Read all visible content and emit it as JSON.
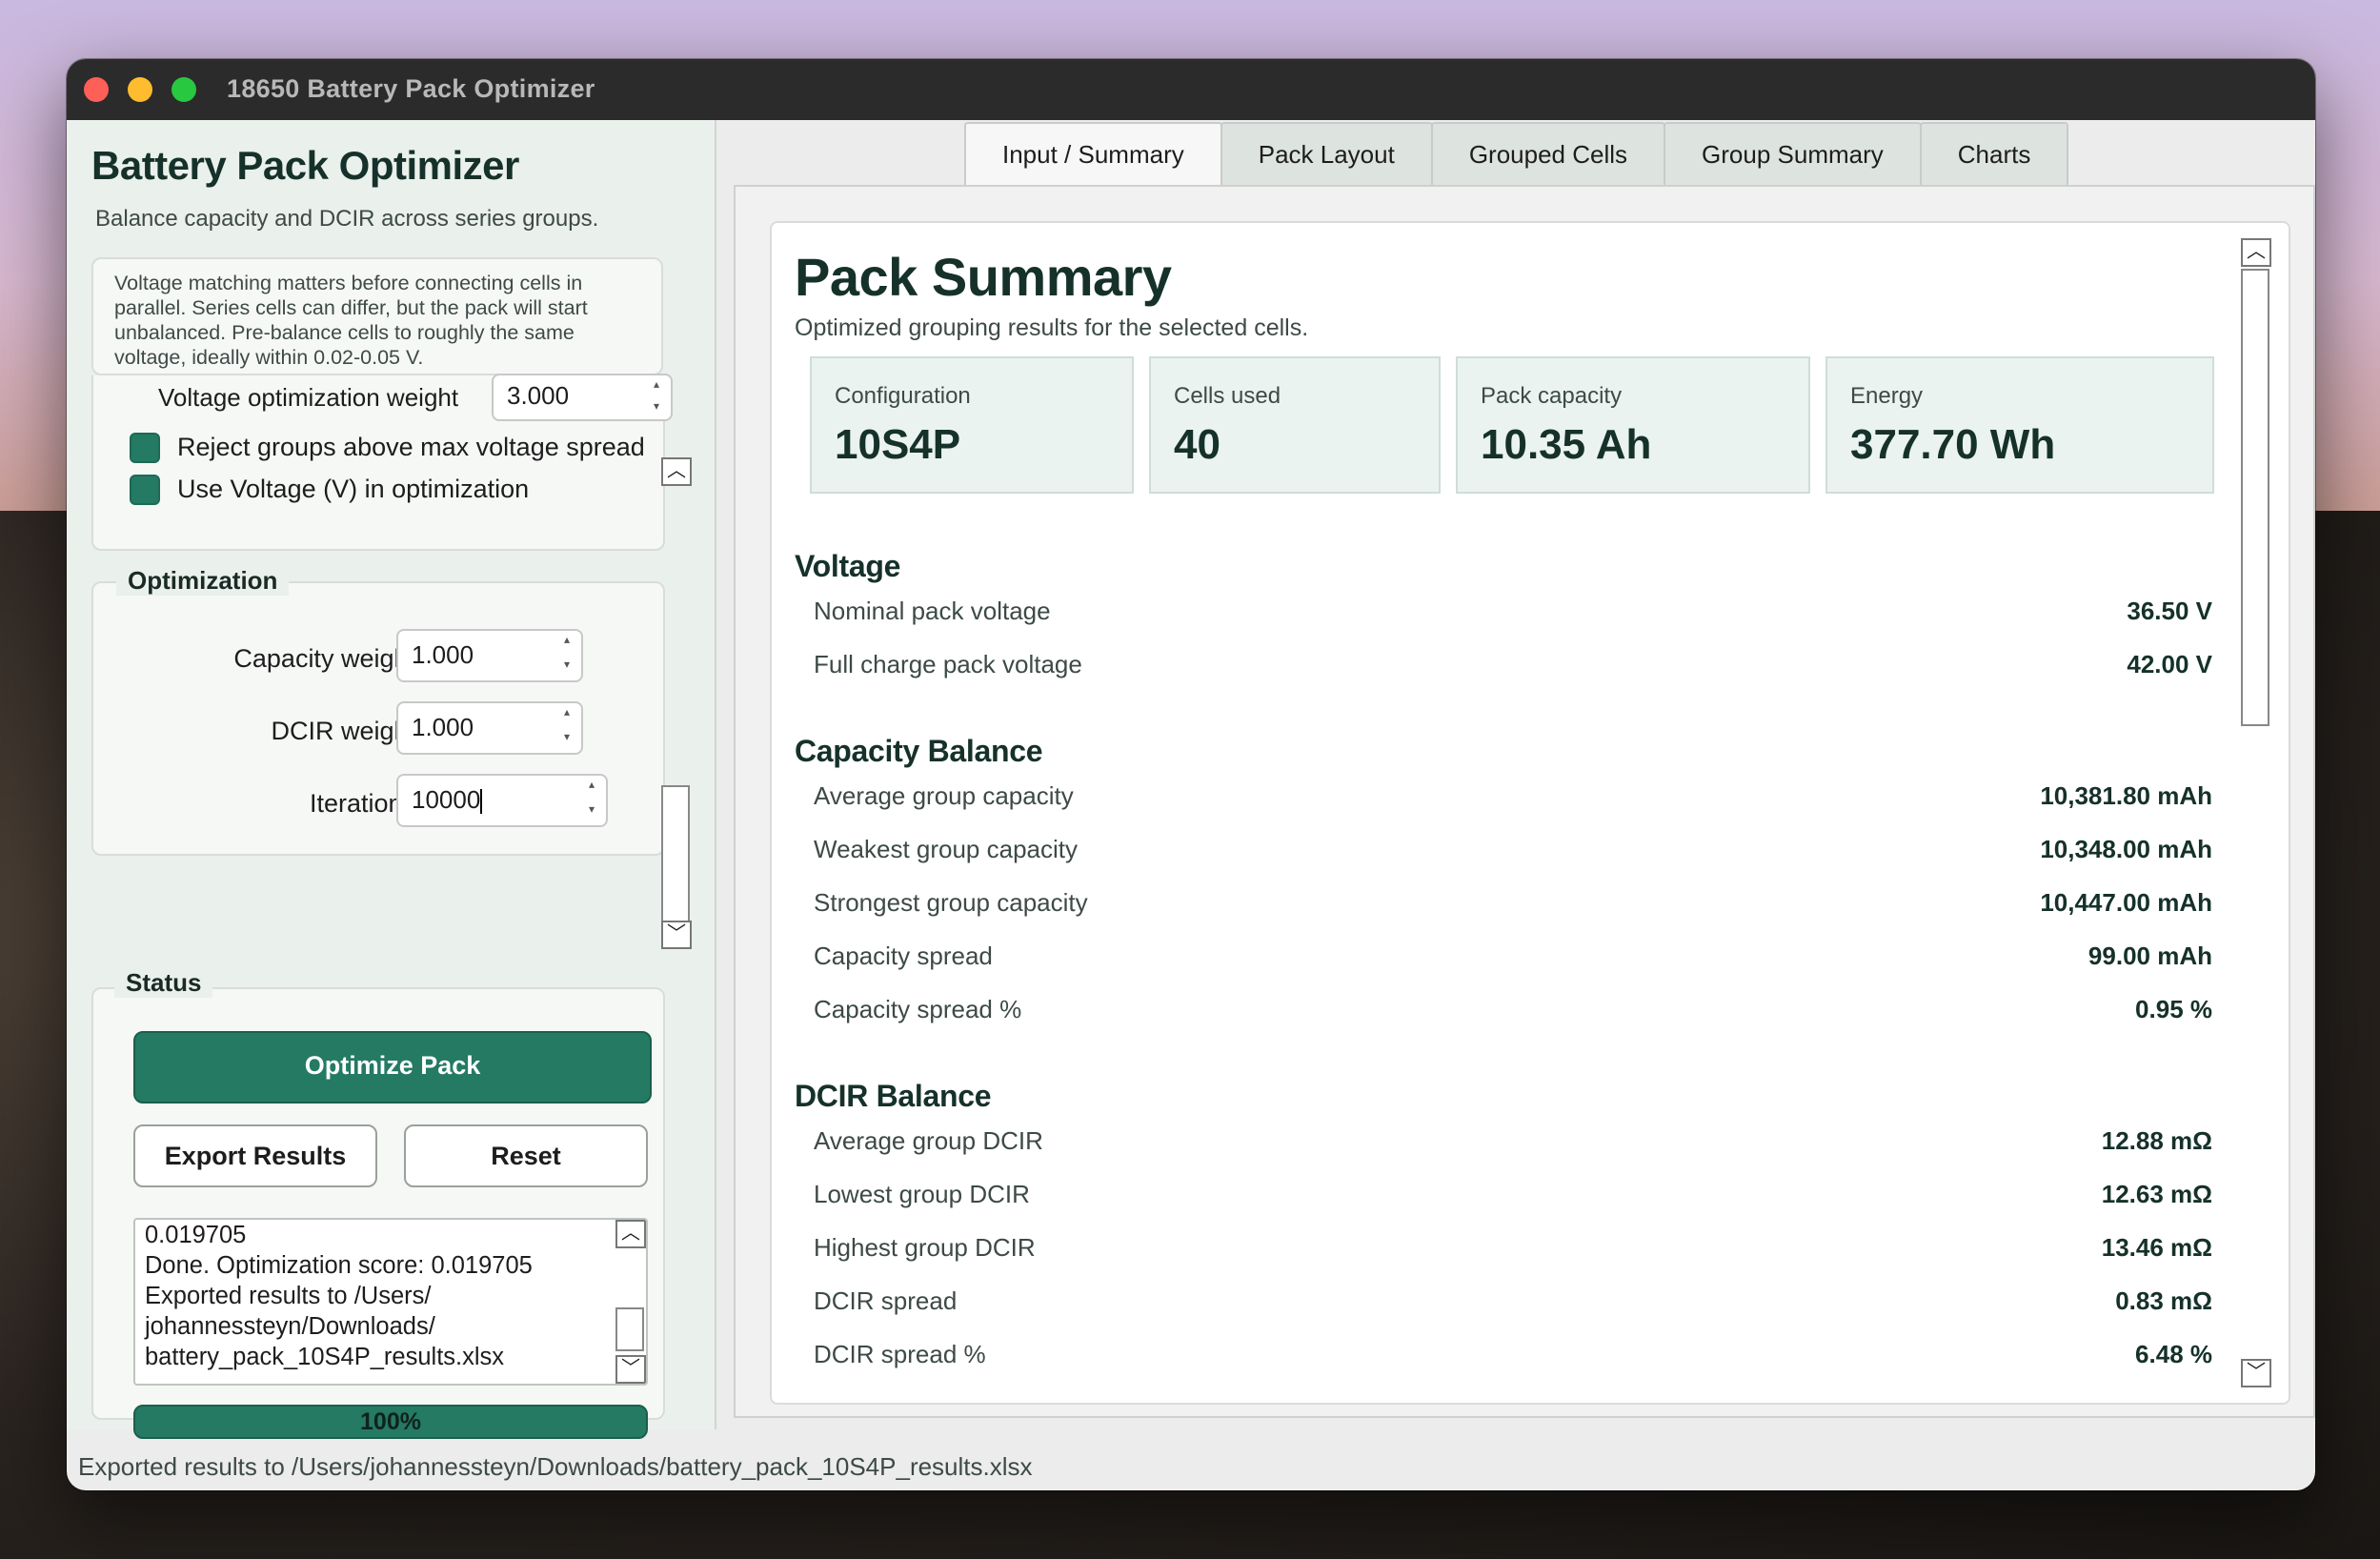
{
  "window": {
    "title": "18650 Battery Pack Optimizer"
  },
  "sidebar": {
    "app_title": "Battery Pack Optimizer",
    "app_subtitle": "Balance capacity and DCIR across series groups.",
    "note": "Voltage matching matters before connecting cells in parallel. Series cells can differ, but the pack will start unbalanced. Pre-balance cells to roughly the same voltage, ideally within 0.02-0.05 V.",
    "voltage_weight_label": "Voltage optimization weight",
    "voltage_weight_value": "3.000",
    "checkbox_reject_label": "Reject groups above max voltage spread",
    "checkbox_use_voltage_label": "Use Voltage (V) in optimization",
    "optimization": {
      "title": "Optimization",
      "capacity_weight_label": "Capacity weight",
      "capacity_weight_value": "1.000",
      "dcir_weight_label": "DCIR weight",
      "dcir_weight_value": "1.000",
      "iterations_label": "Iterations",
      "iterations_value": "10000"
    },
    "status": {
      "title": "Status",
      "optimize_button": "Optimize Pack",
      "export_button": "Export Results",
      "reset_button": "Reset",
      "log_lines": [
        "0.019705",
        "Done. Optimization score: 0.019705",
        "Exported results to /Users/",
        "johannessteyn/Downloads/",
        "battery_pack_10S4P_results.xlsx"
      ],
      "progress_label": "100%",
      "progress": 1.0
    }
  },
  "tabs": [
    "Input / Summary",
    "Pack Layout",
    "Grouped Cells",
    "Group Summary",
    "Charts"
  ],
  "active_tab": "Input / Summary",
  "summary": {
    "title": "Pack Summary",
    "subtitle": "Optimized grouping results for the selected cells.",
    "stats": [
      {
        "label": "Configuration",
        "value": "10S4P"
      },
      {
        "label": "Cells used",
        "value": "40"
      },
      {
        "label": "Pack capacity",
        "value": "10.35 Ah"
      },
      {
        "label": "Energy",
        "value": "377.70 Wh"
      }
    ],
    "voltage": {
      "title": "Voltage",
      "rows": [
        {
          "label": "Nominal pack voltage",
          "value": "36.50 V"
        },
        {
          "label": "Full charge pack voltage",
          "value": "42.00 V"
        }
      ]
    },
    "capacity": {
      "title": "Capacity Balance",
      "rows": [
        {
          "label": "Average group capacity",
          "value": "10,381.80 mAh"
        },
        {
          "label": "Weakest group capacity",
          "value": "10,348.00 mAh"
        },
        {
          "label": "Strongest group capacity",
          "value": "10,447.00 mAh"
        },
        {
          "label": "Capacity spread",
          "value": "99.00 mAh"
        },
        {
          "label": "Capacity spread %",
          "value": "0.95 %"
        }
      ]
    },
    "dcir": {
      "title": "DCIR Balance",
      "rows": [
        {
          "label": "Average group DCIR",
          "value": "12.88 mΩ"
        },
        {
          "label": "Lowest group DCIR",
          "value": "12.63 mΩ"
        },
        {
          "label": "Highest group DCIR",
          "value": "13.46 mΩ"
        },
        {
          "label": "DCIR spread",
          "value": "0.83 mΩ"
        },
        {
          "label": "DCIR spread %",
          "value": "6.48 %"
        }
      ]
    }
  },
  "status_bar": "Exported results to /Users/johannessteyn/Downloads/battery_pack_10S4P_results.xlsx",
  "colors": {
    "accent": "#247a63",
    "panel": "#eaf0ec",
    "stat_bg": "#eaf3ef"
  }
}
